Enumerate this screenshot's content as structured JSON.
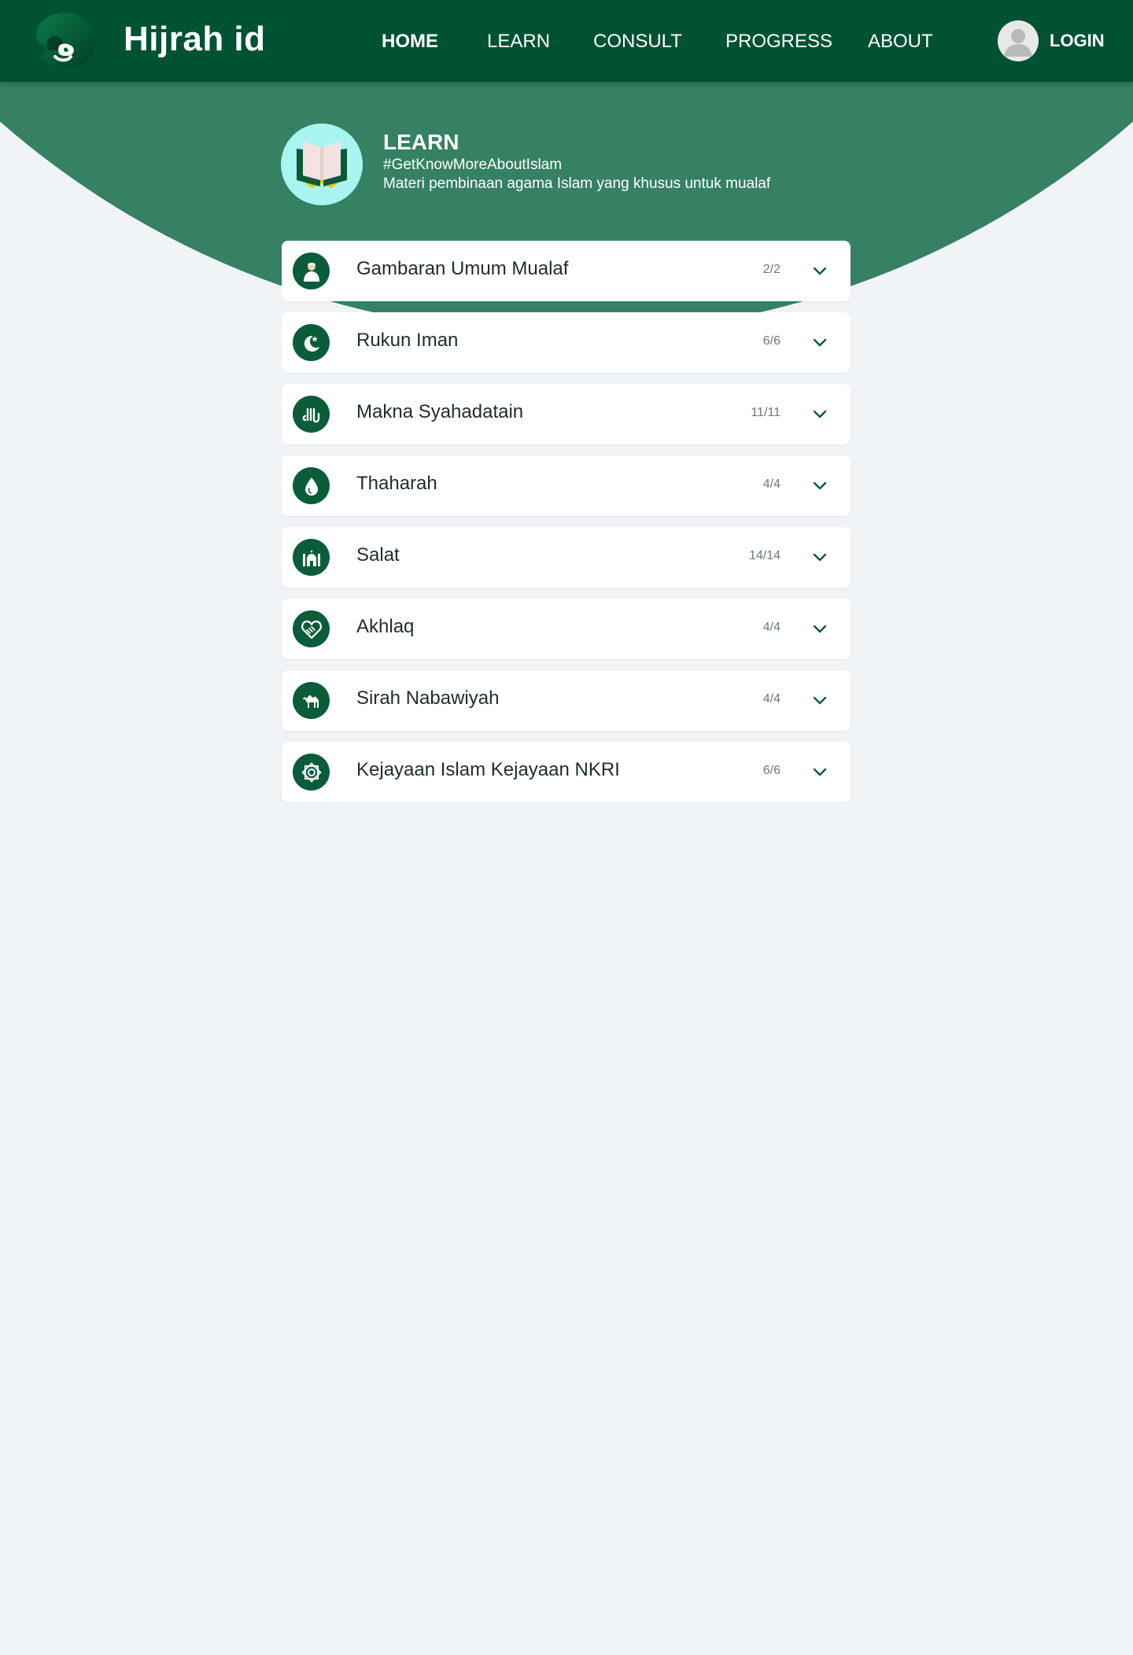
{
  "header": {
    "brand": "Hijrah id",
    "nav": [
      {
        "label": "HOME",
        "active": true
      },
      {
        "label": "LEARN",
        "active": false
      },
      {
        "label": "CONSULT",
        "active": false
      },
      {
        "label": "PROGRESS",
        "active": false
      },
      {
        "label": "ABOUT",
        "active": false
      }
    ],
    "login_label": "LOGIN"
  },
  "learn": {
    "title": "LEARN",
    "tag": "#GetKnowMoreAboutIslam",
    "description": "Materi pembinaan agama Islam yang khusus untuk mualaf"
  },
  "topics": [
    {
      "label": "Gambaran Umum Mualaf",
      "count": "2/2",
      "icon": "person-icon"
    },
    {
      "label": "Rukun Iman",
      "count": "6/6",
      "icon": "crescent-star-icon"
    },
    {
      "label": "Makna Syahadatain",
      "count": "11/11",
      "icon": "allah-calligraphy-icon"
    },
    {
      "label": "Thaharah",
      "count": "4/4",
      "icon": "water-drop-icon"
    },
    {
      "label": "Salat",
      "count": "14/14",
      "icon": "mosque-icon"
    },
    {
      "label": "Akhlaq",
      "count": "4/4",
      "icon": "heart-handshake-icon"
    },
    {
      "label": "Sirah Nabawiyah",
      "count": "4/4",
      "icon": "camel-icon"
    },
    {
      "label": "Kejayaan Islam Kejayaan NKRI",
      "count": "6/6",
      "icon": "islamic-star-icon"
    }
  ],
  "colors": {
    "header_bg": "#005232",
    "hero_green": "#368063",
    "icon_green": "#0a5c3a",
    "page_bg": "#f1f4f7"
  }
}
